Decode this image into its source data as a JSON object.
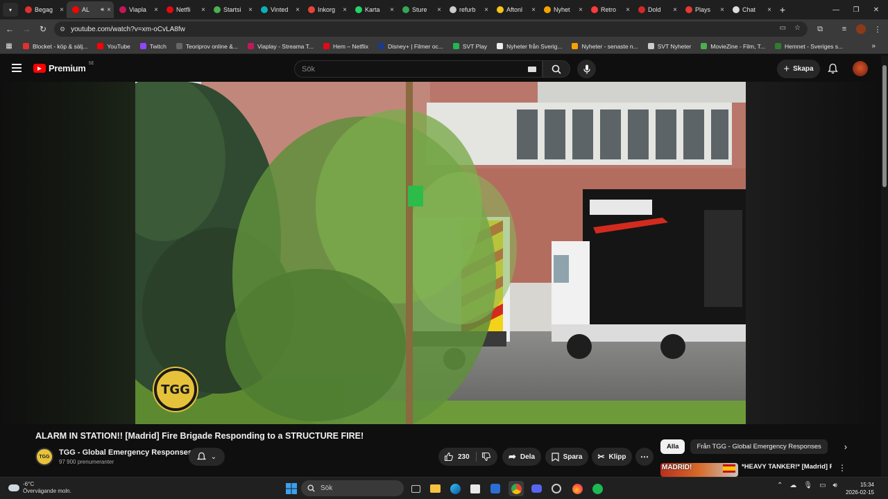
{
  "browser": {
    "tabs": [
      {
        "label": "Begag",
        "color": "#e03030",
        "icon": "blocket-icon"
      },
      {
        "label": "AL",
        "color": "#ff0000",
        "icon": "youtube-icon",
        "active": true,
        "audio": true
      },
      {
        "label": "Viapla",
        "color": "#c2185b",
        "icon": "viaplay-icon"
      },
      {
        "label": "Netfli",
        "color": "#e50914",
        "icon": "netflix-icon"
      },
      {
        "label": "Startsi",
        "color": "#4caf50",
        "icon": "drive-icon"
      },
      {
        "label": "Vinted",
        "color": "#09b1ba",
        "icon": "vinted-icon"
      },
      {
        "label": "Inkorg",
        "color": "#ea4335",
        "icon": "gmail-icon"
      },
      {
        "label": "Karta",
        "color": "#25d366",
        "icon": "whatsapp-icon"
      },
      {
        "label": "Sture",
        "color": "#34a853",
        "icon": "maps-pin-icon"
      },
      {
        "label": "refurb",
        "color": "#cccccc",
        "icon": "globe-icon"
      },
      {
        "label": "Aftonl",
        "color": "#f5c518",
        "icon": "aftonbladet-icon"
      },
      {
        "label": "Nyhet",
        "color": "#f4a300",
        "icon": "news-icon"
      },
      {
        "label": "Retro",
        "color": "#ff3b3b",
        "icon": "retro-icon"
      },
      {
        "label": "Dold",
        "color": "#d62828",
        "icon": "dold-icon"
      },
      {
        "label": "Plays",
        "color": "#e53935",
        "icon": "play-icon"
      },
      {
        "label": "Chat",
        "color": "#dddddd",
        "icon": "chatgpt-icon"
      }
    ],
    "url": "youtube.com/watch?v=xm-oCvLA8fw",
    "bookmarks": [
      {
        "label": "Blocket - köp & sälj...",
        "color": "#e03030"
      },
      {
        "label": "YouTube",
        "color": "#ff0000"
      },
      {
        "label": "Twitch",
        "color": "#9146ff"
      },
      {
        "label": "Teoriprov online &...",
        "color": "#666666"
      },
      {
        "label": "Viaplay - Streama T...",
        "color": "#c2185b"
      },
      {
        "label": "Hem – Netflix",
        "color": "#e50914"
      },
      {
        "label": "Disney+ | Filmer oc...",
        "color": "#1a3a8a"
      },
      {
        "label": "SVT Play",
        "color": "#1db954"
      },
      {
        "label": "Nyheter från Sverig...",
        "color": "#eeeeee"
      },
      {
        "label": "Nyheter - senaste n...",
        "color": "#f4a300"
      },
      {
        "label": "SVT Nyheter",
        "color": "#cccccc"
      },
      {
        "label": "MovieZine - Film, T...",
        "color": "#4caf50"
      },
      {
        "label": "Hemnet - Sveriges s...",
        "color": "#2e7d32"
      }
    ]
  },
  "youtube": {
    "logo_text": "Premium",
    "logo_region": "SE",
    "search_placeholder": "Sök",
    "create_label": "Skapa",
    "video_title": "ALARM IN STATION!! [Madrid] Fire Brigade Responding to a STRUCTURE FIRE!",
    "watermark": "TGG",
    "channel_name": "TGG - Global Emergency Responses",
    "subscribers": "97 900 prenumeranter",
    "likes": "230",
    "share_label": "Dela",
    "save_label": "Spara",
    "clip_label": "Klipp",
    "chips": [
      "Alla",
      "Från TGG - Global Emergency Responses"
    ],
    "rec_title": "*HEAVY TANKER!* [Madrid] Firefighters Respond to FIRE",
    "rec_thumb_text": "MADRID!"
  },
  "taskbar": {
    "temp": "-6°C",
    "weather": "Övervägande moln.",
    "search_label": "Sök",
    "time": "15:34",
    "date": "2026-02-15"
  }
}
